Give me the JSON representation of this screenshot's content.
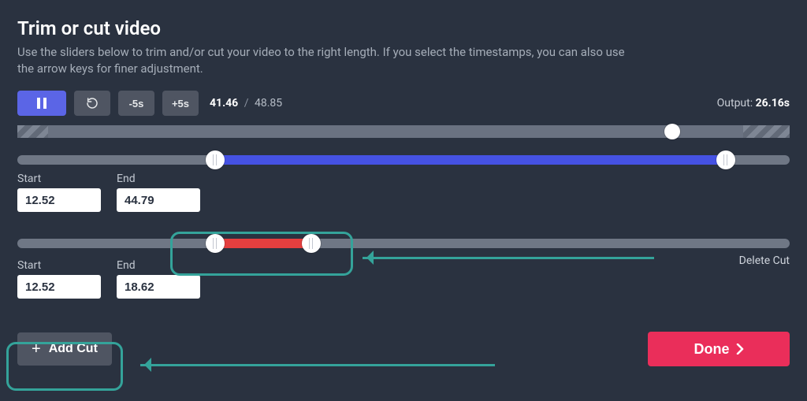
{
  "header": {
    "title": "Trim or cut video",
    "subtitle": "Use the sliders below to trim and/or cut your video to the right length. If you select the timestamps, you can also use the arrow keys for finer adjustment."
  },
  "toolbar": {
    "pause_icon": "pause",
    "replay_icon": "replay",
    "skip_back_label": "-5s",
    "skip_fwd_label": "+5s",
    "current_time": "41.46",
    "separator": "/",
    "total_time": "48.85",
    "output_label": "Output:",
    "output_value": "26.16s"
  },
  "progress": {
    "left_stripe_pct": [
      0,
      4
    ],
    "right_stripe_pct": [
      94,
      100
    ],
    "playhead_pct": 84.8
  },
  "trim": {
    "start_label": "Start",
    "start_value": "12.52",
    "end_label": "End",
    "end_value": "44.79",
    "start_pct": 25.6,
    "end_pct": 91.7
  },
  "cut": {
    "start_label": "Start",
    "start_value": "12.52",
    "end_label": "End",
    "end_value": "18.62",
    "start_pct": 25.6,
    "end_pct": 38.1,
    "delete_label": "Delete Cut"
  },
  "footer": {
    "add_cut_label": "Add Cut",
    "done_label": "Done"
  },
  "colors": {
    "accent": "#5b65e6",
    "danger": "#ea2e5a",
    "cut": "#e43f3f",
    "highlight": "#34a39a"
  }
}
